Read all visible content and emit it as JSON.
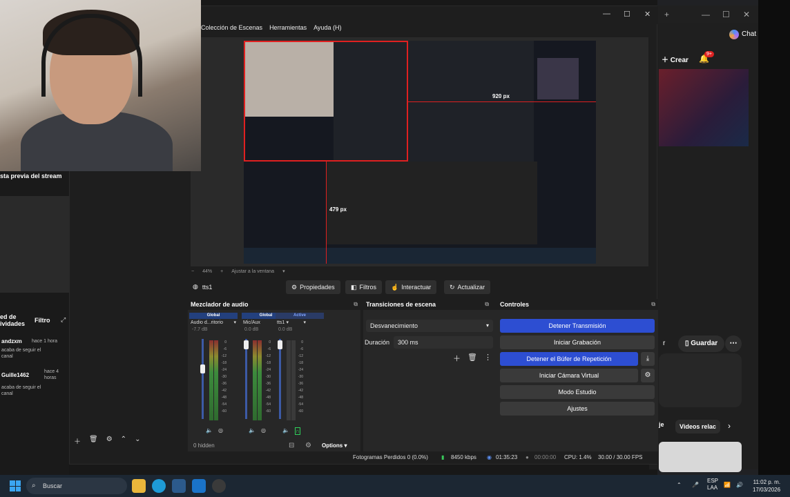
{
  "obs": {
    "menu": [
      "Colección de Escenas",
      "Herramientas",
      "Ayuda (H)"
    ],
    "zoom": "44%",
    "zoom_mode": "Ajustar a la ventana",
    "source_name": "tts1",
    "toolbar": {
      "properties": "Propiedades",
      "filters": "Filtros",
      "interact": "Interactuar",
      "refresh": "Actualizar"
    },
    "preview_labels": {
      "width_px": "920 px",
      "height_px": "479 px"
    }
  },
  "mixer": {
    "title": "Mezclador de audio",
    "channels": [
      {
        "head": "Global",
        "name": "Audio d...ritorio",
        "db": "-7.7 dB",
        "level": 0.88
      },
      {
        "head": "Global",
        "name": "Mic/Aux",
        "db": "0.0 dB",
        "level": 0.98
      },
      {
        "head": "Active",
        "name": "tts1",
        "db": "0.0 dB",
        "level": 0.98
      }
    ],
    "scale": [
      "0",
      "-6",
      "-12",
      "-18",
      "-24",
      "-30",
      "-36",
      "-42",
      "-48",
      "-54",
      "-60"
    ],
    "hidden": "0 hidden",
    "options": "Options"
  },
  "transitions": {
    "title": "Transiciones de escena",
    "selected": "Desvanecimiento",
    "duration_label": "Duración",
    "duration_value": "300 ms"
  },
  "controls": {
    "title": "Controles",
    "stop_stream": "Detener Transmisión",
    "start_rec": "Iniciar Grabación",
    "stop_replay": "Detener el Búfer de Repetición",
    "virtual_cam": "Iniciar Cámara Virtual",
    "studio_mode": "Modo Estudio",
    "settings": "Ajustes"
  },
  "status": {
    "dropped": "Fotogramas Perdidos 0 (0.0%)",
    "bitrate": "8450 kbps",
    "live_time": "01:35:23",
    "rec_time": "00:00:00",
    "cpu": "CPU: 1.4%",
    "fps": "30.00 / 30.00 FPS"
  },
  "stream_panel": {
    "preview_title": "sta previa del stream",
    "activity_title": "ed de ividades",
    "filter": "Filtro",
    "events": [
      {
        "user": "andzxm",
        "time": "hace 1 hora",
        "msg": "acaba de seguir el canal"
      },
      {
        "user": "Guille1462",
        "time": "hace 4 horas",
        "msg": "acaba de seguir el canal"
      }
    ]
  },
  "browser": {
    "chat": "Chat",
    "create": "Crear",
    "notif_count": "9+",
    "save": "Guardar",
    "related": "Videos relac",
    "partial_label": "je",
    "partial_r": "r"
  },
  "taskbar": {
    "search": "Buscar",
    "lang_top": "ESP",
    "lang_bottom": "LAA",
    "time": "11:02 p. m.",
    "date": "17/03/2026"
  }
}
